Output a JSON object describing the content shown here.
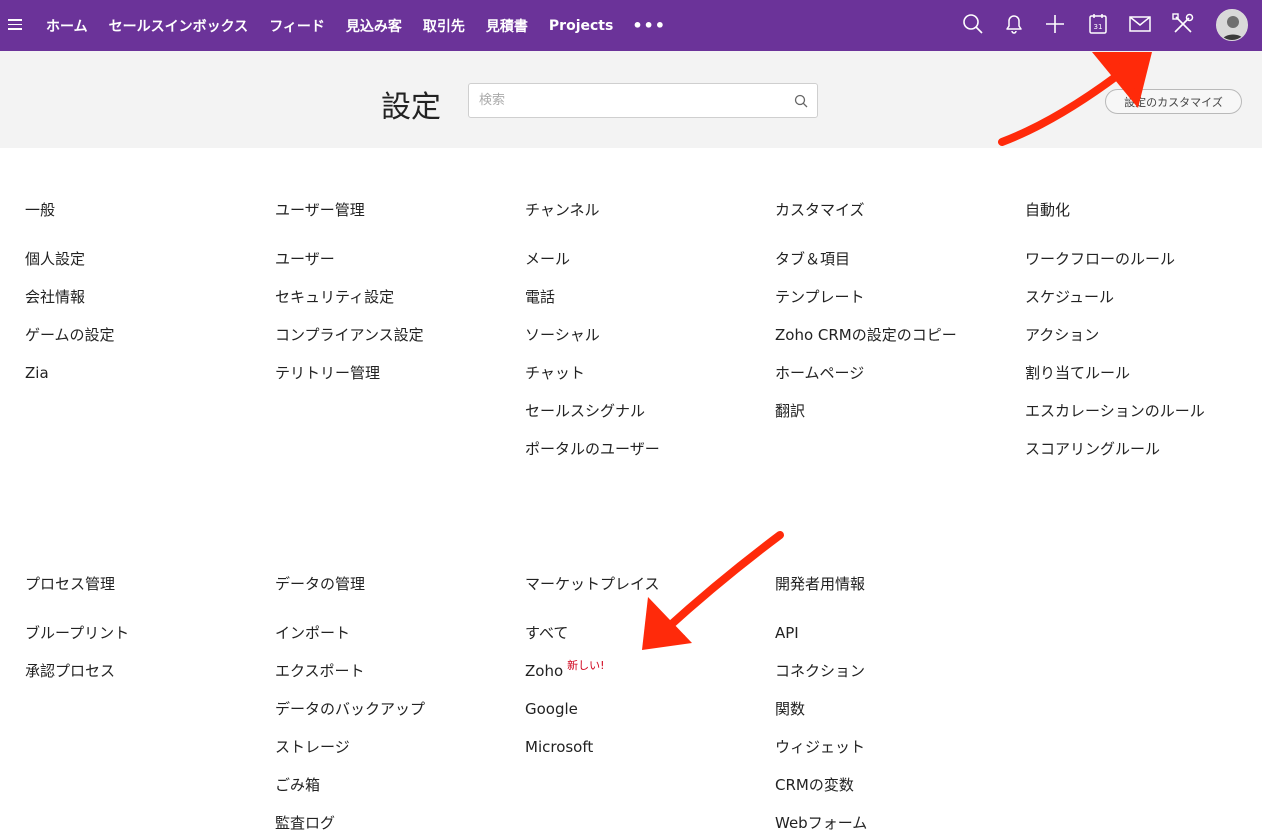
{
  "nav": {
    "items": [
      {
        "label": "ホーム"
      },
      {
        "label": "セールスインボックス"
      },
      {
        "label": "フィード"
      },
      {
        "label": "見込み客"
      },
      {
        "label": "取引先"
      },
      {
        "label": "見積書"
      },
      {
        "label": "Projects"
      }
    ],
    "more": "•••",
    "calendar_day": "31"
  },
  "header": {
    "title": "設定",
    "search_placeholder": "検索",
    "customize_label": "設定のカスタマイズ"
  },
  "sections": [
    {
      "title": "一般",
      "items": [
        "個人設定",
        "会社情報",
        "ゲームの設定",
        "Zia"
      ]
    },
    {
      "title": "ユーザー管理",
      "items": [
        "ユーザー",
        "セキュリティ設定",
        "コンプライアンス設定",
        "テリトリー管理"
      ]
    },
    {
      "title": "チャンネル",
      "items": [
        "メール",
        "電話",
        "ソーシャル",
        "チャット",
        "セールスシグナル",
        "ポータルのユーザー"
      ]
    },
    {
      "title": "カスタマイズ",
      "items": [
        "タブ＆項目",
        "テンプレート",
        "Zoho CRMの設定のコピー",
        "ホームページ",
        "翻訳"
      ]
    },
    {
      "title": "自動化",
      "items": [
        "ワークフローのルール",
        "スケジュール",
        "アクション",
        "割り当てルール",
        "エスカレーションのルール",
        "スコアリングルール"
      ]
    },
    {
      "title": "プロセス管理",
      "items": [
        "ブループリント",
        "承認プロセス"
      ]
    },
    {
      "title": "データの管理",
      "items": [
        "インポート",
        "エクスポート",
        "データのバックアップ",
        "ストレージ",
        "ごみ箱",
        "監査ログ"
      ]
    },
    {
      "title": "マーケットプレイス",
      "items": [
        "すべて",
        "Zoho",
        "Google",
        "Microsoft"
      ],
      "badge": "新しい!"
    },
    {
      "title": "開発者用情報",
      "items": [
        "API",
        "コネクション",
        "関数",
        "ウィジェット",
        "CRMの変数",
        "Webフォーム"
      ]
    }
  ],
  "colors": {
    "topbar": "#6b3399",
    "annotation": "#ff2a0a",
    "badge": "#d0021b"
  }
}
